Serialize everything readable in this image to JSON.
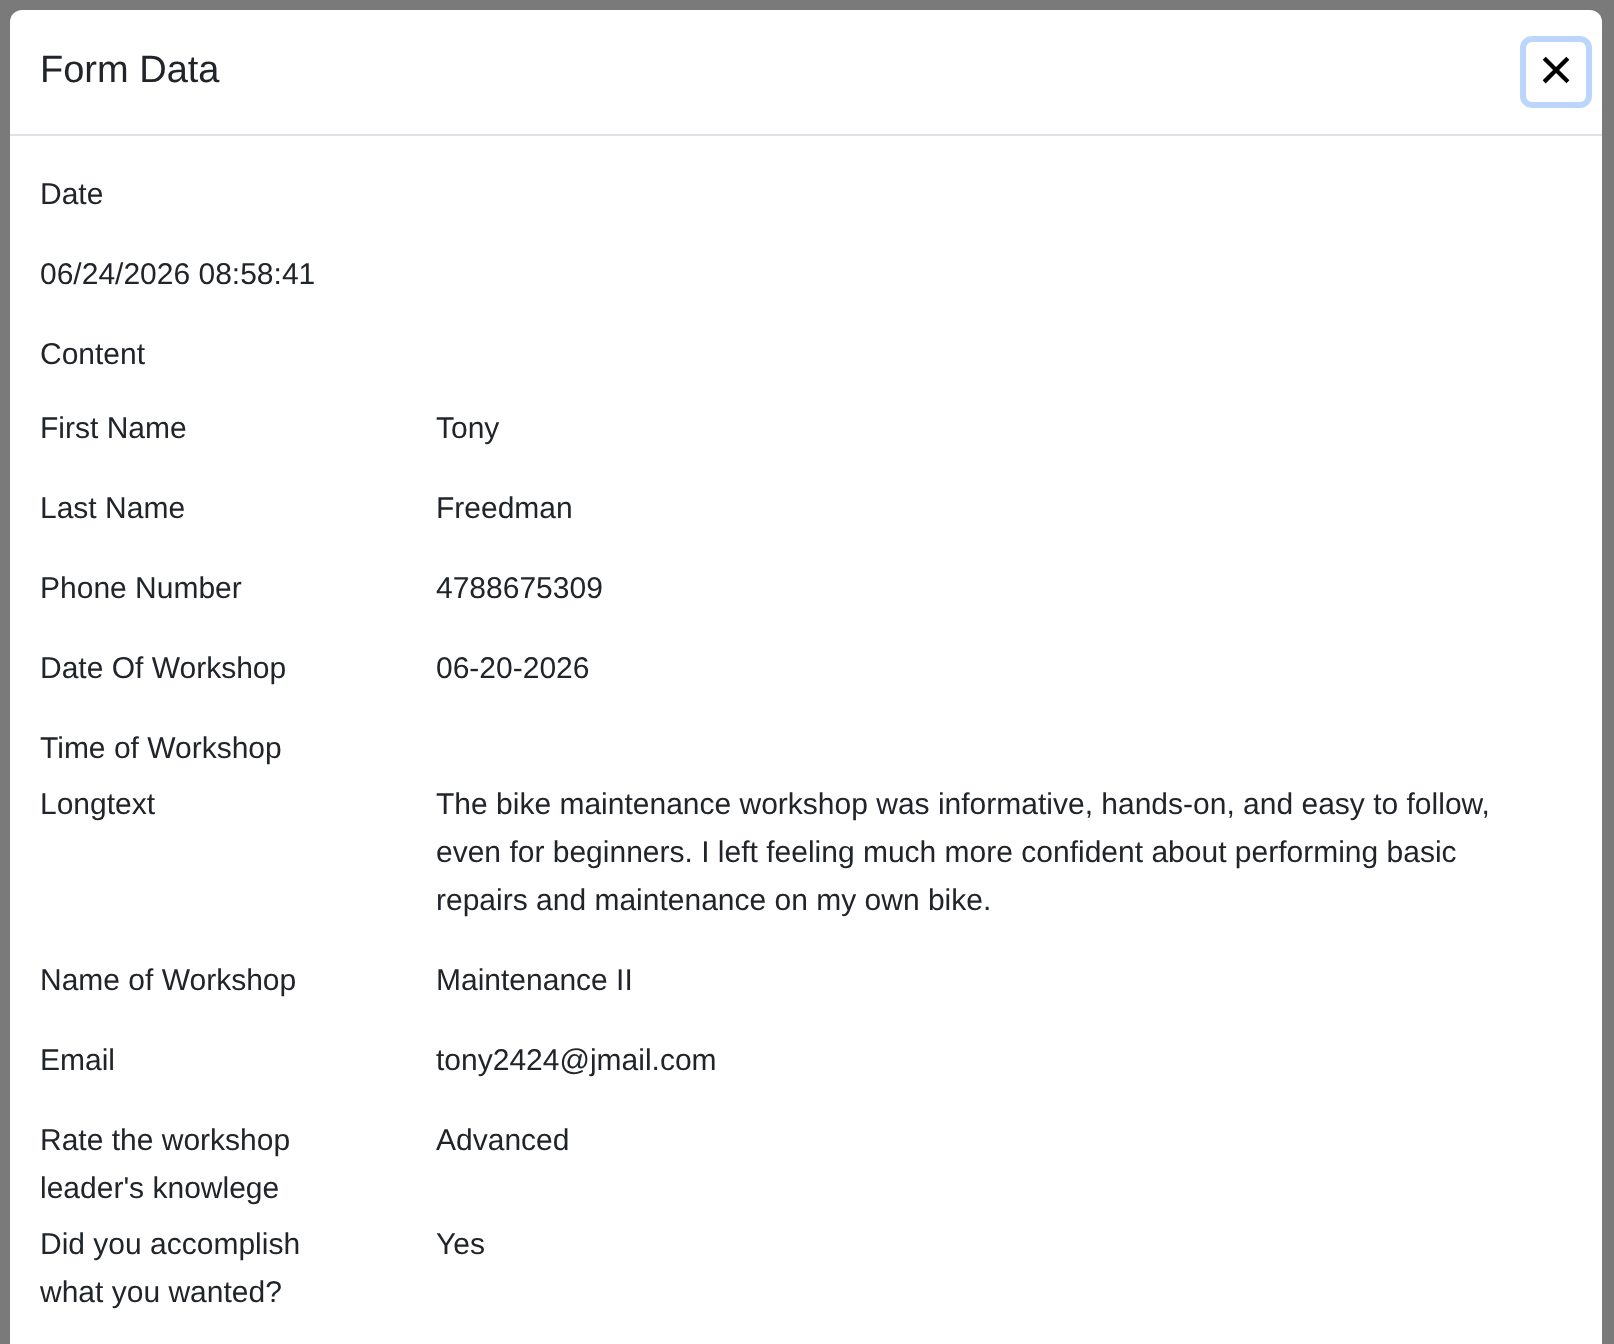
{
  "modal": {
    "title": "Form Data",
    "close_label": "×"
  },
  "date": {
    "label": "Date",
    "value": "06/24/2026 08:58:41"
  },
  "content": {
    "label": "Content"
  },
  "rows": [
    {
      "label": "First Name",
      "value": "Tony"
    },
    {
      "label": "Last Name",
      "value": "Freedman"
    },
    {
      "label": "Phone Number",
      "value": "4788675309"
    },
    {
      "label": "Date Of Workshop",
      "value": "06-20-2026"
    },
    {
      "label": "Time of Workshop"
    },
    {
      "label": "Longtext",
      "value": "The bike maintenance workshop was informative, hands-on, and easy to follow, even for beginners. I left feeling much more confident about performing basic repairs and maintenance on my own bike."
    },
    {
      "label": "Name of Workshop",
      "value": "Maintenance II"
    },
    {
      "label": "Email",
      "value": "tony2424@jmail.com"
    },
    {
      "label": "Rate the workshop leader's knowlege",
      "value": "Advanced"
    },
    {
      "label": "Did you accomplish what you wanted?",
      "value": "Yes"
    }
  ]
}
